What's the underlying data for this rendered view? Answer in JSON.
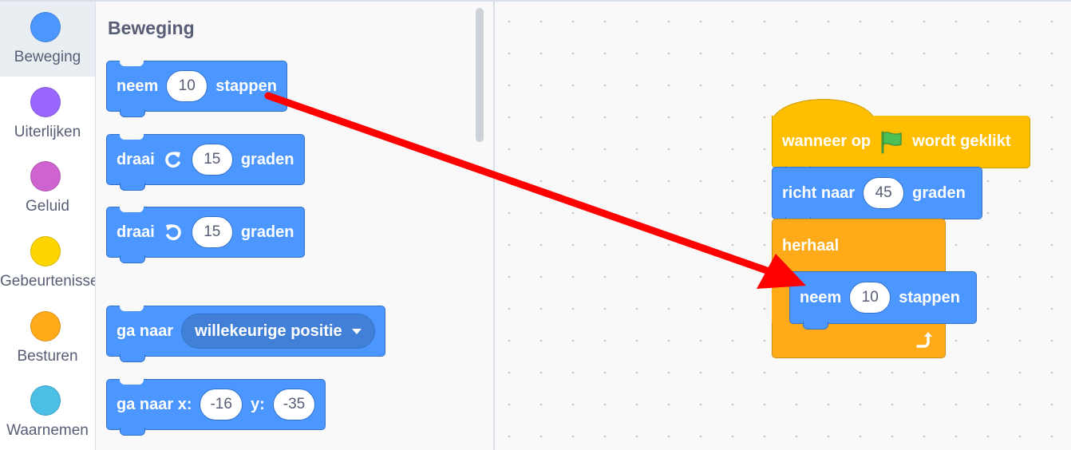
{
  "categories": [
    {
      "label": "Beweging",
      "color": "#4c97ff",
      "active": true
    },
    {
      "label": "Uiterlijken",
      "color": "#9966ff"
    },
    {
      "label": "Geluid",
      "color": "#cf63cf"
    },
    {
      "label": "Gebeurtenissen",
      "color": "#ffd500"
    },
    {
      "label": "Besturen",
      "color": "#ffab19"
    },
    {
      "label": "Waarnemen",
      "color": "#4cbfe6"
    }
  ],
  "palette": {
    "title": "Beweging",
    "move": {
      "text1": "neem",
      "value": "10",
      "text2": "stappen"
    },
    "turn_right": {
      "text1": "draai",
      "value": "15",
      "text2": "graden",
      "icon": "rotate-right-icon"
    },
    "turn_left": {
      "text1": "draai",
      "value": "15",
      "text2": "graden",
      "icon": "rotate-left-icon"
    },
    "goto": {
      "text1": "ga naar",
      "dropdown": "willekeurige positie"
    },
    "goto_xy": {
      "text1": "ga naar x:",
      "x": "-16",
      "text2": "y:",
      "y": "-35"
    }
  },
  "script": {
    "when_flag": {
      "text1": "wanneer op",
      "text2": "wordt geklikt",
      "icon": "green-flag-icon"
    },
    "point": {
      "text1": "richt naar",
      "value": "45",
      "text2": "graden"
    },
    "repeat": {
      "text1": "herhaal",
      "icon": "loop-arrow-icon"
    },
    "move": {
      "text1": "neem",
      "value": "10",
      "text2": "stappen"
    }
  },
  "annotation": {
    "color": "#ff0000",
    "type": "drag-arrow"
  }
}
